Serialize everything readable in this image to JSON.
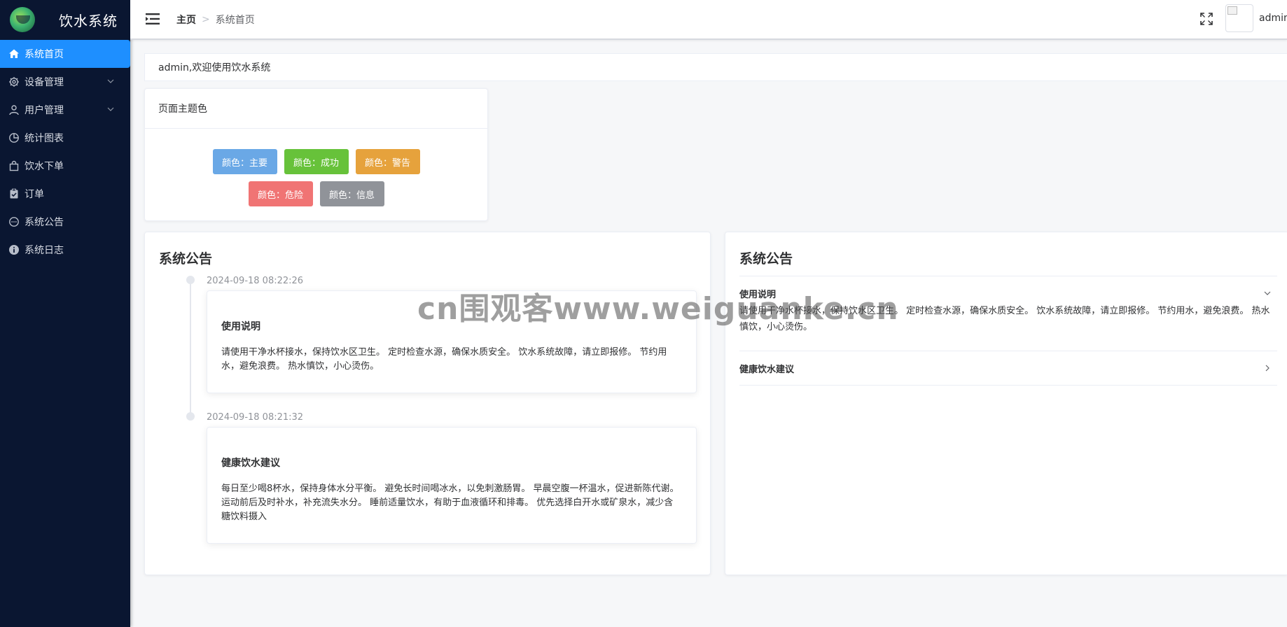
{
  "app": {
    "title": "饮水系统"
  },
  "sidebar": {
    "items": [
      {
        "label": "系统首页",
        "icon": "home-icon",
        "active": true
      },
      {
        "label": "设备管理",
        "icon": "gear-icon",
        "has_children": true
      },
      {
        "label": "用户管理",
        "icon": "user-icon",
        "has_children": true
      },
      {
        "label": "统计图表",
        "icon": "pie-chart-icon"
      },
      {
        "label": "饮水下单",
        "icon": "shopping-bag-icon"
      },
      {
        "label": "订单",
        "icon": "clipboard-check-icon"
      },
      {
        "label": "系统公告",
        "icon": "chat-bubble-icon"
      },
      {
        "label": "系统日志",
        "icon": "info-icon"
      }
    ]
  },
  "header": {
    "breadcrumb": {
      "home": "主页",
      "current": "系统首页"
    },
    "user_name": "admin"
  },
  "welcome": {
    "text": "admin,欢迎使用饮水系统"
  },
  "theme": {
    "title": "页面主题色",
    "swatches": [
      {
        "label": "颜色：主要",
        "color": "#6aa8e6"
      },
      {
        "label": "颜色：成功",
        "color": "#67c23a"
      },
      {
        "label": "颜色：警告",
        "color": "#e6a23c"
      },
      {
        "label": "颜色：危险",
        "color": "#f07474"
      },
      {
        "label": "颜色：信息",
        "color": "#909399"
      }
    ]
  },
  "announcements": {
    "title": "系统公告",
    "items": [
      {
        "time": "2024-09-18 08:22:26",
        "title": "使用说明",
        "body": "请使用干净水杯接水，保持饮水区卫生。 定时检查水源，确保水质安全。 饮水系统故障，请立即报修。 节约用水，避免浪费。 热水慎饮，小心烫伤。"
      },
      {
        "time": "2024-09-18 08:21:32",
        "title": "健康饮水建议",
        "body": "每日至少喝8杯水，保持身体水分平衡。 避免长时间喝冰水，以免刺激肠胃。 早晨空腹一杯温水，促进新陈代谢。 运动前后及时补水，补充流失水分。 睡前适量饮水，有助于血液循环和排毒。 优先选择白开水或矿泉水，减少含糖饮料摄入"
      }
    ]
  },
  "accordion": {
    "title": "系统公告",
    "items": [
      {
        "title": "使用说明",
        "expanded": true,
        "body": "请使用干净水杯接水，保持饮水区卫生。 定时检查水源，确保水质安全。 饮水系统故障，请立即报修。 节约用水，避免浪费。 热水慎饮，小心烫伤。"
      },
      {
        "title": "健康饮水建议",
        "expanded": false
      }
    ]
  },
  "watermark": {
    "text": "cn围观客www.weiguanke.cn"
  }
}
